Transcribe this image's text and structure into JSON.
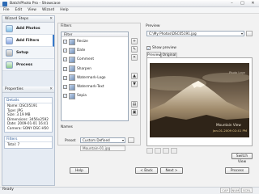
{
  "window": {
    "title": "BatchPhoto Pro - Showcase"
  },
  "menu": [
    "File",
    "Edit",
    "View",
    "Wizard",
    "Help"
  ],
  "wizard_steps": {
    "header": "Wizard Steps",
    "items": [
      {
        "label": "Add Photos"
      },
      {
        "label": "Add Filters"
      },
      {
        "label": "Setup"
      },
      {
        "label": "Process"
      }
    ]
  },
  "properties": {
    "header": "Properties",
    "details_title": "Details",
    "details": [
      "Name: DSC05191",
      "Type: JPG",
      "Size: 3.19 MB",
      "Dimensions: 3456x2592",
      "Date: 2009-01-01 16:41",
      "Camera: SONY DSC-H50"
    ],
    "filters_title": "Filters",
    "filters": [
      "Total: 7"
    ]
  },
  "filters_panel": {
    "label": "Filters",
    "list_header": "Filter",
    "items": [
      {
        "name": "Resize",
        "checked": true
      },
      {
        "name": "Date",
        "checked": true
      },
      {
        "name": "Comment",
        "checked": true
      },
      {
        "name": "Sharpen",
        "checked": true
      },
      {
        "name": "Watermark-Logo",
        "checked": true
      },
      {
        "name": "Watermark-Text",
        "checked": true
      },
      {
        "name": "Sepia",
        "checked": true
      }
    ],
    "names_label": "Names",
    "preset_label": "Preset",
    "preset_value": "Custom Defined",
    "preset_name_placeholder": "Mountain-01.jpg"
  },
  "preview_panel": {
    "label": "Preview",
    "path": "C:\\My Photos\\DSC05191.jpg",
    "show_preview_label": "Show preview",
    "tabs": [
      "Preview",
      "Original"
    ],
    "watermark_logo": "Photo Logo",
    "watermark_text": "Mountain View",
    "date_stamp": "Jan-01-2009 02:41 PM",
    "switch_view": "Switch View"
  },
  "buttons": {
    "help": "Help",
    "back": "< Back",
    "next": "Next >",
    "process": "Process"
  },
  "status": {
    "text": "Ready",
    "keys": [
      "CAP",
      "NUM",
      "SCRL"
    ]
  }
}
